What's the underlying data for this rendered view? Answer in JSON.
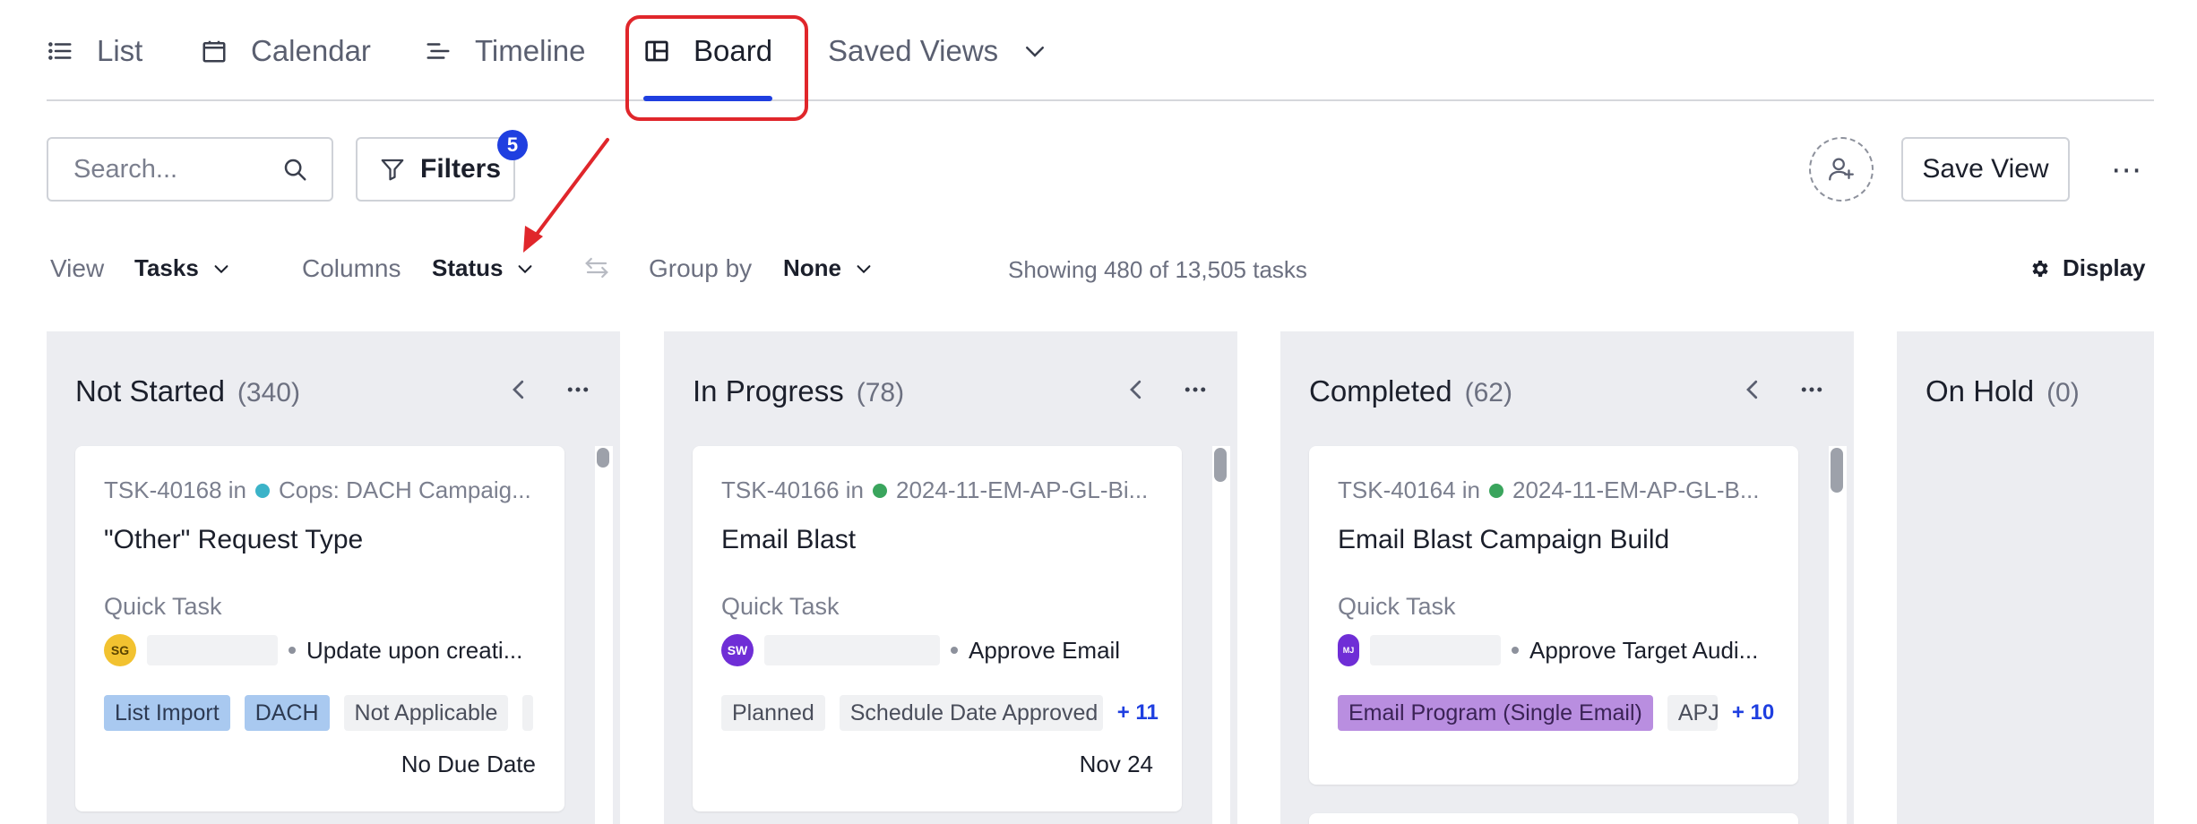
{
  "view_tabs": [
    {
      "label": "List",
      "icon": "list-icon"
    },
    {
      "label": "Calendar",
      "icon": "calendar-icon"
    },
    {
      "label": "Timeline",
      "icon": "timeline-icon"
    },
    {
      "label": "Board",
      "icon": "board-icon",
      "active": true
    },
    {
      "label": "Saved Views",
      "icon": "chevron-down-icon"
    }
  ],
  "toolbar": {
    "search_placeholder": "Search...",
    "filters_label": "Filters",
    "filters_count": "5",
    "save_view_label": "Save View"
  },
  "settings": {
    "view_label": "View",
    "view_value": "Tasks",
    "columns_label": "Columns",
    "columns_value": "Status",
    "group_label": "Group by",
    "group_value": "None",
    "showing_text": "Showing 480 of 13,505 tasks",
    "display_label": "Display"
  },
  "columns": [
    {
      "title": "Not Started",
      "count": "(340)",
      "card": {
        "id_text": "TSK-40168 in",
        "project": "Cops: DACH Campaig...",
        "project_color": "#3bb3c8",
        "title": "\"Other\" Request Type",
        "type": "Quick Task",
        "avatar_initials": "SG",
        "avatar_color": "#f2c230",
        "activity": "Update upon creati...",
        "tags": [
          "List Import",
          "DACH",
          "Not Applicable"
        ],
        "due": "No Due Date"
      }
    },
    {
      "title": "In Progress",
      "count": "(78)",
      "card": {
        "id_text": "TSK-40166 in",
        "project": "2024-11-EM-AP-GL-Bi...",
        "project_color": "#3aa55d",
        "title": "Email Blast",
        "type": "Quick Task",
        "avatar_initials": "SW",
        "avatar_color": "#6f2ed6",
        "activity": "Approve Email",
        "tags": [
          "Planned",
          "Schedule Date Approved"
        ],
        "more_tags": "+ 11",
        "due": "Nov 24"
      }
    },
    {
      "title": "Completed",
      "count": "(62)",
      "card": {
        "id_text": "TSK-40164 in",
        "project": "2024-11-EM-AP-GL-B...",
        "project_color": "#3aa55d",
        "title": "Email Blast Campaign Build",
        "type": "Quick Task",
        "avatar_initials": "MJ",
        "avatar_color": "#6f2ed6",
        "activity": "Approve Target Audi...",
        "tags": [
          "Email Program (Single Email)",
          "APJ"
        ],
        "more_tags": "+ 10"
      }
    },
    {
      "title": "On Hold",
      "count": "(0)"
    }
  ]
}
